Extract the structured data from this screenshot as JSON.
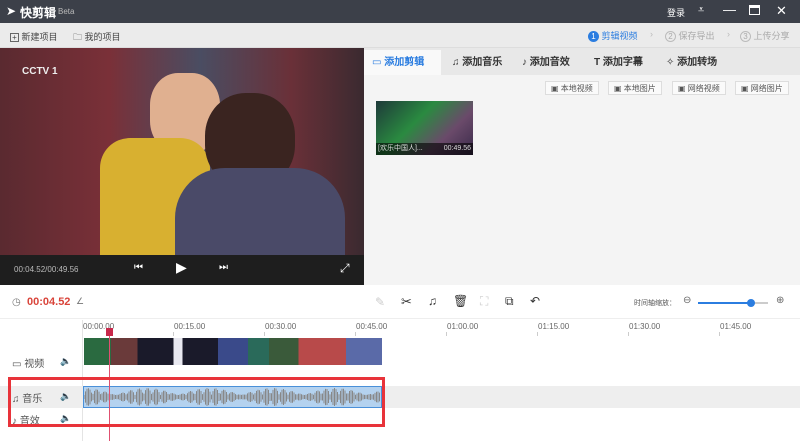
{
  "app": {
    "title": "快剪辑",
    "badge": "Beta",
    "login": "登录"
  },
  "toolbar": {
    "new_project": "新建项目",
    "my_projects": "我的项目",
    "steps": [
      {
        "num": "1",
        "label": "剪辑视频"
      },
      {
        "num": "2",
        "label": "保存导出"
      },
      {
        "num": "3",
        "label": "上传分享"
      }
    ]
  },
  "player": {
    "time": "00:04.52/00:49.56",
    "logo": "CCTV 1"
  },
  "tabs": [
    {
      "label": "添加剪辑"
    },
    {
      "label": "添加音乐"
    },
    {
      "label": "添加音效"
    },
    {
      "label": "添加字幕"
    },
    {
      "label": "添加转场"
    }
  ],
  "sources": [
    "本地视频",
    "本地图片",
    "网络视频",
    "网络图片"
  ],
  "clip": {
    "name": "[欢乐中国人]...",
    "duration": "00:49.56"
  },
  "timeline": {
    "current_time": "00:04.52",
    "zoom_label": "时间轴缩放：",
    "zoom_value": 0.75,
    "ticks": [
      "00:00.00",
      "00:15.00",
      "00:30.00",
      "00:45.00",
      "01:00.00",
      "01:15.00",
      "01:30.00",
      "01:45.00"
    ],
    "tracks": [
      {
        "label": "视频"
      },
      {
        "label": "音乐"
      },
      {
        "label": "音效"
      }
    ]
  },
  "colors": {
    "accent": "#2b7de0",
    "highlight": "#e8333a",
    "time": "#d9443a"
  }
}
